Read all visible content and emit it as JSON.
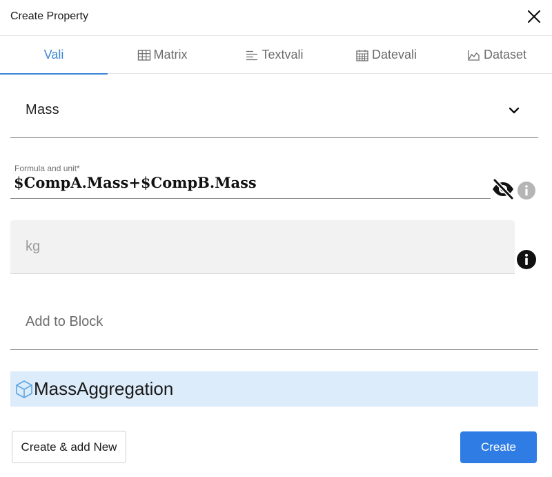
{
  "dialog": {
    "title": "Create Property",
    "close_icon": "close-icon"
  },
  "tabs": [
    {
      "label": "Vali",
      "icon": "",
      "active": true
    },
    {
      "label": "Matrix",
      "icon": "table-grid-icon",
      "active": false
    },
    {
      "label": "Textvali",
      "icon": "text-lines-icon",
      "active": false
    },
    {
      "label": "Datevali",
      "icon": "calendar-icon",
      "active": false
    },
    {
      "label": "Dataset",
      "icon": "area-chart-icon",
      "active": false
    }
  ],
  "property_select": {
    "value": "Mass",
    "icon": "chevron-down-icon"
  },
  "formula": {
    "label": "Formula and unit*",
    "expression": "$CompA.Mass+$CompB.Mass",
    "visibility_icon": "eye-slash-icon",
    "info_icon": "info-icon"
  },
  "unit": {
    "placeholder": "kg",
    "info_icon": "info-icon"
  },
  "block": {
    "placeholder": "Add to Block"
  },
  "selected_item": {
    "name": "MassAggregation",
    "icon": "cube-icon"
  },
  "actions": {
    "secondary_label": "Create & add New",
    "primary_label": "Create"
  },
  "colors": {
    "accent": "#3a86d6",
    "primary_button": "#2f7de4",
    "selected_row": "#ddecfb",
    "disabled_field": "#f2f2f2"
  }
}
